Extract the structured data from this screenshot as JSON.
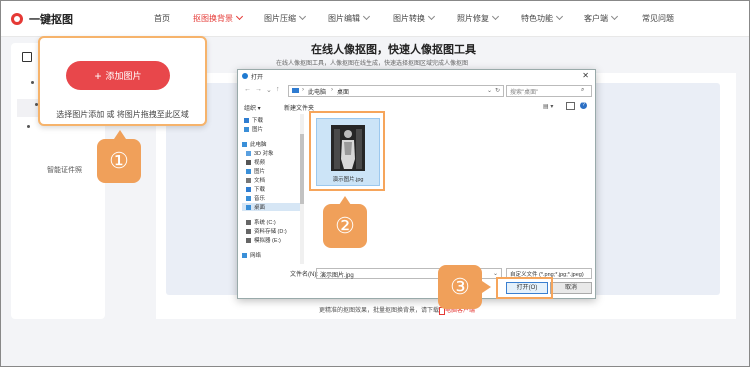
{
  "logo_text": "一键抠图",
  "nav": [
    {
      "label": "首页",
      "chevron": false,
      "active": false
    },
    {
      "label": "抠图换背景",
      "chevron": true,
      "active": true
    },
    {
      "label": "图片压缩",
      "chevron": true,
      "active": false
    },
    {
      "label": "图片编辑",
      "chevron": true,
      "active": false
    },
    {
      "label": "图片转换",
      "chevron": true,
      "active": false
    },
    {
      "label": "照片修复",
      "chevron": true,
      "active": false
    },
    {
      "label": "特色功能",
      "chevron": true,
      "active": false
    },
    {
      "label": "客户端",
      "chevron": true,
      "active": false
    },
    {
      "label": "常见问题",
      "chevron": false,
      "active": false
    }
  ],
  "sidebar": {
    "partial_label": "智能证件照"
  },
  "main": {
    "title": "在线人像抠图，快速人像抠图工具",
    "subtitle": "在线人像抠图工具，人像抠图在线生成，快速选择抠图区域完成人像抠图"
  },
  "callout": {
    "button_label": "添加图片",
    "hint": "选择图片添加 或 将图片拖拽至此区域"
  },
  "badges": [
    "①",
    "②",
    "③"
  ],
  "bottom_note": {
    "prefix": "更精准的抠图效果，批量抠图换背景，请下载",
    "link": "电脑客户端"
  },
  "dialog": {
    "title": "打开",
    "close": "✕",
    "breadcrumb": [
      "此电脑",
      "桌面"
    ],
    "search_placeholder": "搜索\"桌面\"",
    "organize": "组织 ▾",
    "new_folder": "新建文件夹",
    "nav_items": [
      {
        "label": "下载",
        "icon": "download-icon",
        "color": "#2f7dd1"
      },
      {
        "label": "图片",
        "icon": "pictures-icon",
        "color": "#3a8fd8"
      },
      {
        "label": "此电脑",
        "icon": "computer-icon",
        "color": "#3a8fd8"
      },
      {
        "label": "3D 对象",
        "icon": "3d-objects-icon",
        "color": "#5aa0e0"
      },
      {
        "label": "视频",
        "icon": "video-icon",
        "color": "#555"
      },
      {
        "label": "图片",
        "icon": "pictures-icon",
        "color": "#3a8fd8"
      },
      {
        "label": "文档",
        "icon": "documents-icon",
        "color": "#777"
      },
      {
        "label": "下载",
        "icon": "download-icon",
        "color": "#2f7dd1"
      },
      {
        "label": "音乐",
        "icon": "music-icon",
        "color": "#3a8fd8"
      },
      {
        "label": "桌面",
        "icon": "desktop-icon",
        "color": "#3a8fd8"
      },
      {
        "label": "系统 (C:)",
        "icon": "drive-icon",
        "color": "#666"
      },
      {
        "label": "资料存储 (D:)",
        "icon": "drive-icon",
        "color": "#666"
      },
      {
        "label": "模拟器 (E:)",
        "icon": "drive-icon",
        "color": "#666"
      },
      {
        "label": "网络",
        "icon": "network-icon",
        "color": "#3a8fd8"
      }
    ],
    "selected_nav_index": 9,
    "file": {
      "name": "演示图片.jpg"
    },
    "filename_label": "文件名(N):",
    "filename_value": "演示图片.jpg",
    "filetype": "自定义文件 (*.png;*.jpg;*.jpeg)",
    "open_button": "打开(O)",
    "cancel_button": "取消"
  },
  "colors": {
    "accent": "#e53935",
    "highlight": "#f6a55b",
    "badge": "#f0a05a"
  }
}
